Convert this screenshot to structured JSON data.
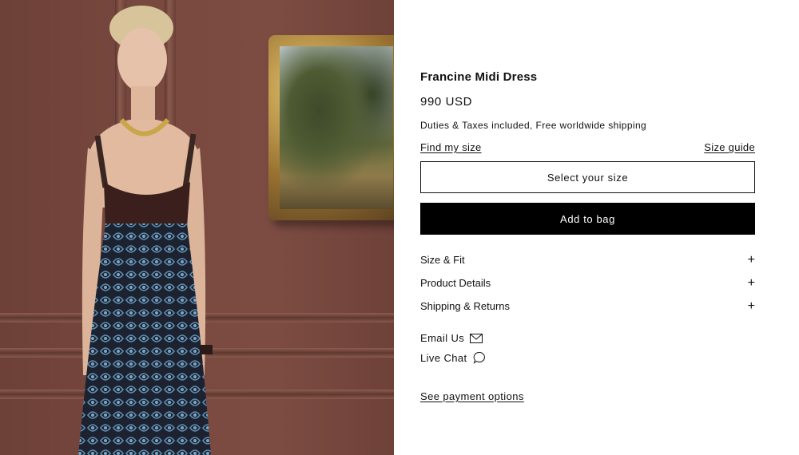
{
  "product": {
    "title": "Francine Midi Dress",
    "price": "990 USD",
    "duties_note": "Duties & Taxes included, Free worldwide shipping"
  },
  "links": {
    "find_size": "Find my size",
    "size_guide": "Size guide",
    "payment_options": "See payment options"
  },
  "actions": {
    "select_size": "Select your size",
    "add_to_bag": "Add to bag"
  },
  "accordion": [
    {
      "label": "Size & Fit",
      "icon": "plus-icon"
    },
    {
      "label": "Product Details",
      "icon": "plus-icon"
    },
    {
      "label": "Shipping & Returns",
      "icon": "plus-icon"
    }
  ],
  "contact": {
    "email_label": "Email Us",
    "email_icon": "envelope-icon",
    "chat_label": "Live Chat",
    "chat_icon": "chat-bubble-icon"
  },
  "colors": {
    "button_primary": "#000000",
    "text": "#111111",
    "background": "#ffffff"
  }
}
